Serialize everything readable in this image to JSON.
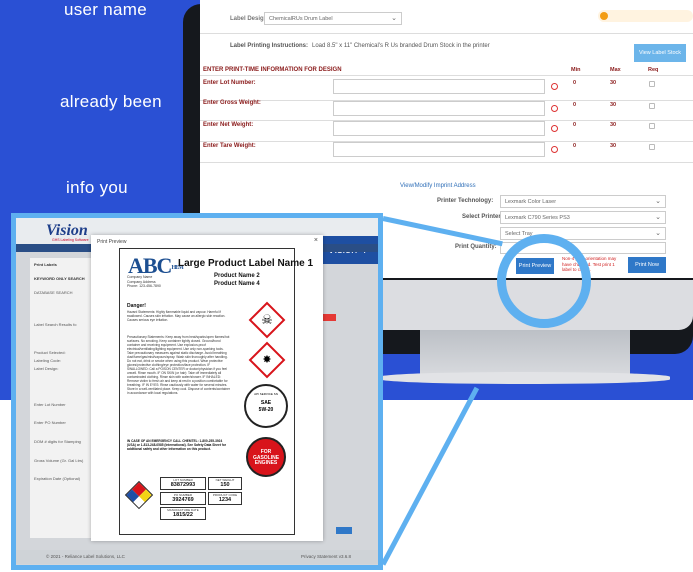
{
  "promo": {
    "line1": "user name",
    "line2": "already been",
    "line3": "info you"
  },
  "app": {
    "label_design_label": "Label Design:",
    "label_design_value": "ChemicalRUs Drum Label",
    "instructions_label": "Label Printing Instructions:",
    "instructions_text": "Load 8.5\" x 11\" Chemical's R Us branded Drum Stock in the printer",
    "view_label_stock": "View Label Stock",
    "section_title": "ENTER PRINT-TIME INFORMATION FOR DESIGN",
    "col_min": "Min",
    "col_max": "Max",
    "col_req": "Req",
    "fields": [
      {
        "label": "Enter Lot Number:",
        "min": "0",
        "max": "30"
      },
      {
        "label": "Enter Gross Weight:",
        "min": "0",
        "max": "30"
      },
      {
        "label": "Enter Net Weight:",
        "min": "0",
        "max": "30"
      },
      {
        "label": "Enter Tare Weight:",
        "min": "0",
        "max": "30"
      }
    ],
    "imprint_link": "View/Modify Imprint Address",
    "printer_tech_label": "Printer Technology:",
    "printer_tech_value": "Lexmark Color Laser",
    "select_printer_label": "Select Printer:",
    "select_printer_value": "Lexmark C790 Series PS3",
    "tray_value": "Select Tray",
    "quantity_label": "Print Quantity:",
    "warning_text": "Non-4 print orientation may have changed. Test print 1 label to check.",
    "print_preview": "Print Preview",
    "print_now": "Print Now"
  },
  "zoom": {
    "logo": "Vision",
    "logo_sub": "GHS Labeling Software",
    "version": "Vision 4",
    "side_title": "Print Labels",
    "side_items": [
      "KEYWORD ONLY SEARCH",
      "DATABASE SEARCH",
      "Label Search Results fo",
      "Product Selected:",
      "Labeling Code:",
      "Label Design:"
    ],
    "zfields": [
      "Enter Lot Number",
      "Enter PO Number",
      "DOM # digits for Stamping",
      "Gross Volume (Gr. Gal Ltrs)",
      "Expiration Date (Optional)"
    ],
    "footer_left": "© 2021 - Reliance Label Solutions, LLC",
    "footer_right": "Privacy Statement   v3.6.8",
    "modal_title": "Print Preview",
    "label": {
      "brand": "ABC",
      "brand_suffix": "HEM",
      "company_line1": "Company Name",
      "company_line2": "Company Address",
      "company_line3": "Phone: 123-456-7890",
      "title": "Large Product Label Name 1",
      "name2": "Product Name 2",
      "name4": "Product Name 4",
      "signal": "Danger!",
      "hazard_text": "Hazard Statements: Highly flammable liquid and vapour. Harmful if swallowed. Causes skin irritation. May cause an allergic skin reaction. Causes serious eye irritation.",
      "precaution_text": "Precautionary Statements: Keep away from heat/sparks/open flames/hot surfaces. No smoking. Keep container tightly closed. Ground/bond container and receiving equipment. Use explosion-proof electrical/ventilating/lighting equipment. Use only non-sparking tools. Take precautionary measures against static discharge. Avoid breathing dust/fume/gas/mist/vapours/spray. Wash skin thoroughly after handling. Do not eat, drink or smoke when using this product. Wear protective gloves/protective clothing/eye protection/face protection. IF SWALLOWED: Call a POISON CENTER or doctor/physician if you feel unwell. Rinse mouth. IF ON SKIN (or hair): Take off immediately all contaminated clothing. Rinse skin with water/shower. IF INHALED: Remove victim to fresh air and keep at rest in a position comfortable for breathing. IF IN EYES: Rinse cautiously with water for several minutes. Store in a well-ventilated place. Keep cool. Dispose of contents/container in accordance with local regulations.",
      "emergency_text": "IN CASE OF AN EMERGENCY CALL CHEMTEL: 1-800-255-3924 (USA) or 1-813-248-0585 (International). See Safety Data Sheet for additional safety and other information on this product.",
      "lot_label": "LOT NUMBER",
      "lot": "83872993",
      "net_label": "NET WEIGHT",
      "net": "150",
      "po_label": "PO NUMBER",
      "po": "3924769",
      "code_label": "PRODUCT CODE",
      "code": "1234",
      "date_label": "MANUFACTURE DATE",
      "date": "1815/22",
      "nfpa": [
        "2",
        "3",
        "1"
      ],
      "sae_top": "SAE",
      "sae_mid": "5W-20",
      "sae_ring": "API SERVICE SN",
      "gasoline": "FOR GASOLINE ENGINES"
    }
  }
}
